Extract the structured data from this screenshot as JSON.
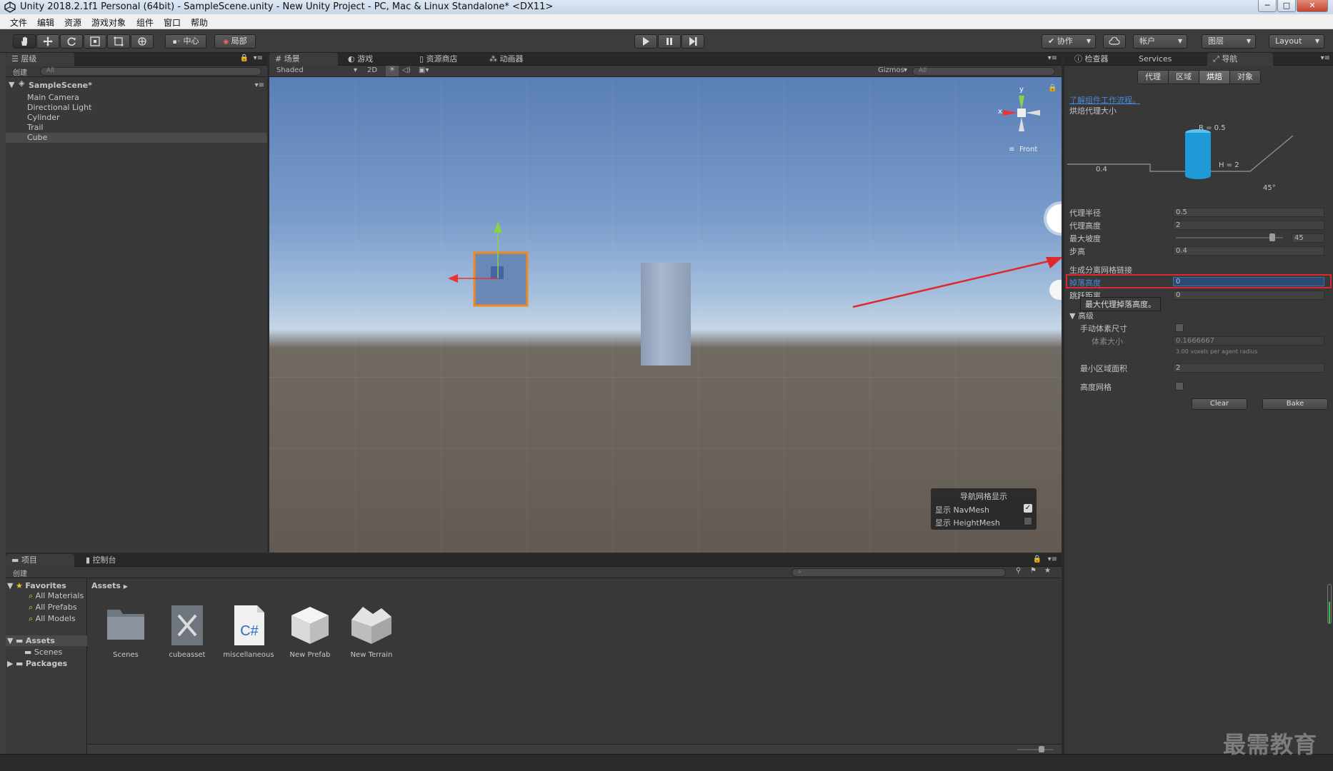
{
  "window": {
    "title": "Unity 2018.2.1f1 Personal (64bit) - SampleScene.unity - New Unity Project - PC, Mac & Linux Standalone* <DX11>",
    "minimize": "─",
    "maximize": "□",
    "close": "✕"
  },
  "menubar": [
    "文件",
    "编辑",
    "资源",
    "游戏对象",
    "组件",
    "窗口",
    "帮助"
  ],
  "toolbar": {
    "pivot_label": "中心",
    "space_label": "局部",
    "collab_label": "协作",
    "account_label": "帐户",
    "layers_label": "图层",
    "layout_label": "Layout"
  },
  "hierarchy": {
    "tab": "层级",
    "create_label": "创建",
    "search_placeholder": "All",
    "scene_name": "SampleScene*",
    "items": [
      "Main Camera",
      "Directional Light",
      "Cylinder",
      "Trail",
      "Cube"
    ]
  },
  "scene": {
    "tabs": [
      "场景",
      "游戏",
      "资源商店",
      "动画器"
    ],
    "shading_mode": "Shaded",
    "mode_2d": "2D",
    "gizmos_label": "Gizmos",
    "search_placeholder": "All",
    "gizmo": {
      "y": "y",
      "x": "x",
      "view": "Front"
    },
    "navmesh_overlay": {
      "title": "导航网格显示",
      "show_navmesh": "显示 NavMesh",
      "show_navmesh_checked": true,
      "show_heightmesh": "显示 HeightMesh",
      "show_heightmesh_checked": false
    }
  },
  "inspector": {
    "tabs": [
      "检查器",
      "Services",
      "导航"
    ],
    "sub_tabs": [
      "代理",
      "区域",
      "烘焙",
      "对象"
    ],
    "active_sub_tab": "烘焙",
    "link": "了解组件工作流程。",
    "section_title": "烘焙代理大小",
    "diagram": {
      "radius": "R = 0.5",
      "height": "H = 2",
      "step": "0.4",
      "angle": "45°",
      "cylinder_color": "#1e9bd6"
    },
    "fields": {
      "agent_radius": {
        "label": "代理半径",
        "value": "0.5"
      },
      "agent_height": {
        "label": "代理高度",
        "value": "2"
      },
      "max_slope": {
        "label": "最大坡度",
        "value": "45",
        "fraction": 0.9
      },
      "step_height": {
        "label": "步高",
        "value": "0.4"
      }
    },
    "offmesh_title": "生成分离网格链接",
    "drop_height": {
      "label": "掉落高度",
      "value": "0"
    },
    "jump_distance": {
      "label": "跳跃距离",
      "value": "0"
    },
    "tooltip": "最大代理掉落高度。",
    "advanced": {
      "title": "高级",
      "manual_voxel": "手动体素尺寸",
      "voxel_size": {
        "label": "体素大小",
        "value": "0.1666667"
      },
      "voxel_hint": "3.00 voxels per agent radius",
      "min_region": {
        "label": "最小区域面积",
        "value": "2"
      },
      "height_mesh": "高度网格"
    },
    "buttons": {
      "clear": "Clear",
      "bake": "Bake"
    },
    "highlight_color": "#e0272d"
  },
  "project": {
    "tabs": [
      "项目",
      "控制台"
    ],
    "create_label": "创建",
    "favorites": "Favorites",
    "favorite_items": [
      "All Materials",
      "All Prefabs",
      "All Models"
    ],
    "assets_root": "Assets",
    "asset_folders": [
      "Scenes"
    ],
    "packages": "Packages",
    "breadcrumb": "Assets",
    "assets": [
      "Scenes",
      "cubeasset",
      "miscellaneous",
      "New Prefab",
      "New Terrain"
    ]
  },
  "watermark": "最需教育"
}
